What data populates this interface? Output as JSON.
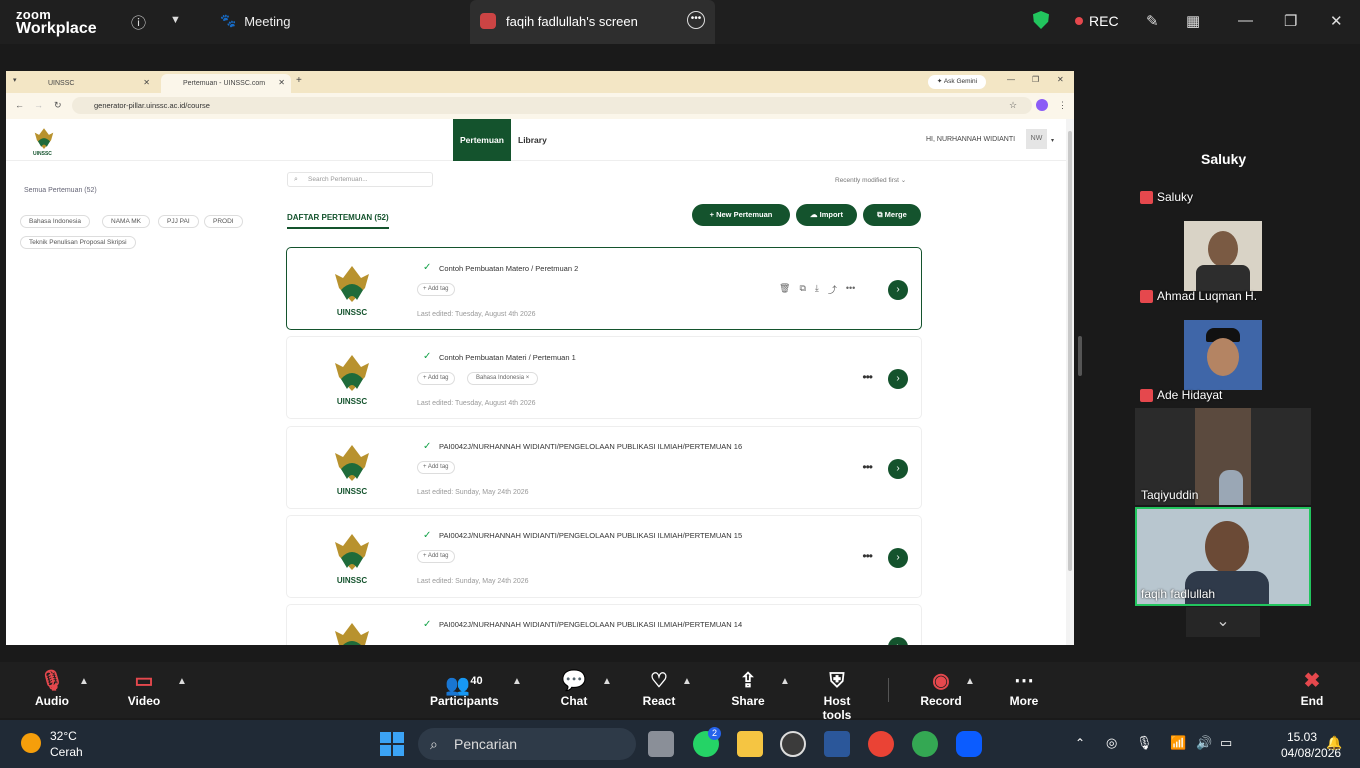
{
  "zoom": {
    "brand_top": "zoom",
    "brand_bottom": "Workplace",
    "meeting_label": "Meeting",
    "share_tab_label": "faqih fadlullah's screen",
    "rec_label": "REC"
  },
  "browser": {
    "tabs": [
      {
        "label": "UINSSC"
      },
      {
        "label": "Pertemuan - UINSSC.com"
      }
    ],
    "ask_gemini": "Ask Gemini",
    "url": "generator-pillar.uinssc.ac.id/course"
  },
  "app": {
    "logo_text": "UINSSC",
    "nav": [
      {
        "label": "Pertemuan"
      },
      {
        "label": "Library"
      }
    ],
    "greeting": "HI, NURHANNAH WIDIANTI",
    "avatar_initials": "NW",
    "sidebar": {
      "title": "Semua Pertemuan (52)",
      "chips": [
        "Bahasa Indonesia",
        "NAMA MK",
        "PJJ PAI",
        "PRODI",
        "Teknik Penulisan Proposal Skripsi"
      ]
    },
    "search_placeholder": "Search Pertemuan...",
    "sort_label": "Recently modified first",
    "list_title": "DAFTAR PERTEMUAN (52)",
    "buttons": {
      "new": "+ New Pertemuan",
      "import": "Import",
      "merge": "Merge"
    },
    "add_tag": "+ Add tag",
    "cards": [
      {
        "title": "Contoh Pembuatan Matero / Peretmuan 2",
        "edited": "Last edited: Tuesday, August 4th 2026",
        "tag": ""
      },
      {
        "title": "Contoh Pembuatan Materi / Pertemuan 1",
        "edited": "Last edited: Tuesday, August 4th 2026",
        "tag": "Bahasa Indonesia ×"
      },
      {
        "title": "PAI0042J/NURHANNAH WIDIANTI/PENGELOLAAN PUBLIKASI ILMIAH/PERTEMUAN 16",
        "edited": "Last edited: Sunday, May 24th 2026",
        "tag": ""
      },
      {
        "title": "PAI0042J/NURHANNAH WIDIANTI/PENGELOLAAN PUBLIKASI ILMIAH/PERTEMUAN 15",
        "edited": "Last edited: Sunday, May 24th 2026",
        "tag": ""
      },
      {
        "title": "PAI0042J/NURHANNAH WIDIANTI/PENGELOLAAN PUBLIKASI ILMIAH/PERTEMUAN 14",
        "edited": "",
        "tag": ""
      }
    ]
  },
  "gallery": {
    "active_speaker": "Saluky",
    "participants": [
      {
        "name": "Saluky"
      },
      {
        "name": "Ahmad Luqman H."
      },
      {
        "name": "Ade Hidayat"
      },
      {
        "name": "Taqiyuddin"
      },
      {
        "name": "faqih fadlullah"
      }
    ]
  },
  "toolbar": {
    "audio": "Audio",
    "video": "Video",
    "participants": "Participants",
    "participants_count": "40",
    "chat": "Chat",
    "react": "React",
    "share": "Share",
    "host_tools": "Host tools",
    "record": "Record",
    "more": "More",
    "end": "End"
  },
  "taskbar": {
    "temperature": "32°C",
    "weather": "Cerah",
    "search": "Pencarian",
    "whatsapp_badge": "2",
    "time": "15.03",
    "date": "04/08/2026"
  },
  "colors": {
    "brand_green": "#14532d",
    "rec_red": "#e5484d",
    "active_tile": "#22c55e"
  }
}
